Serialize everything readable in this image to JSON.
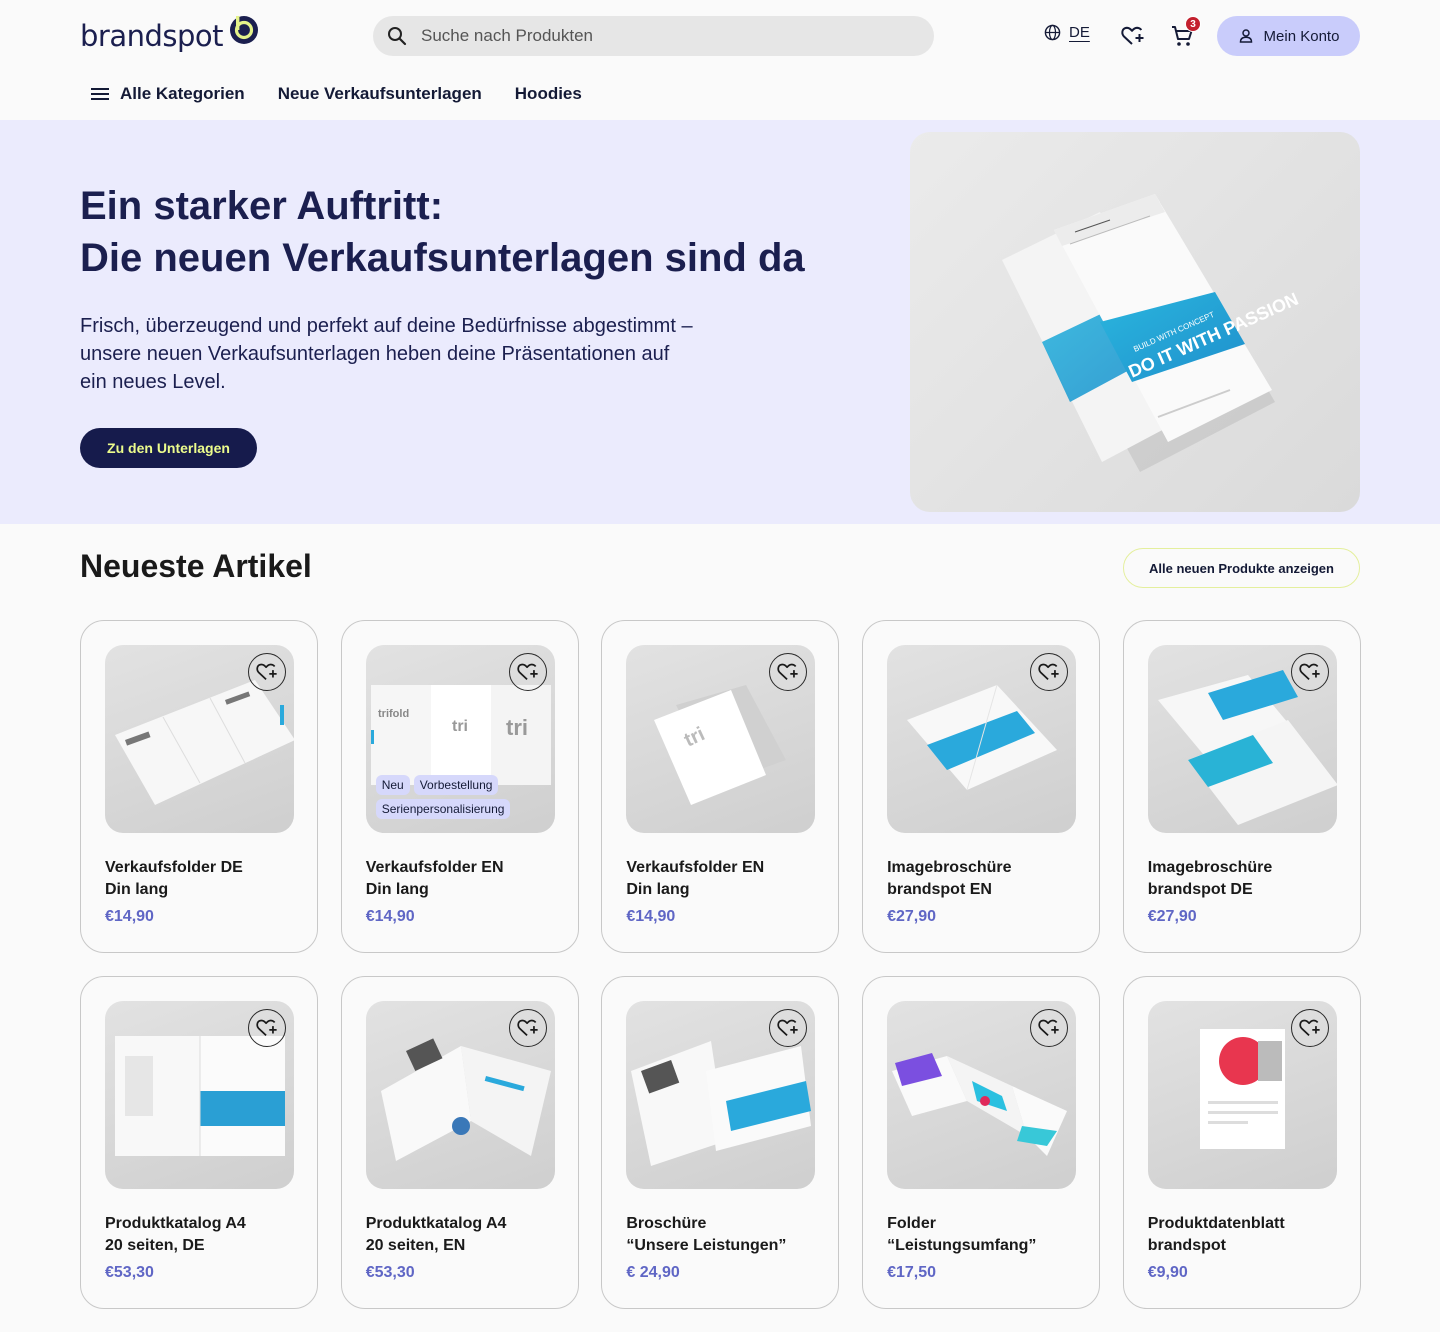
{
  "brand": {
    "logo_text": "brandspot",
    "accent": "#1b1f4f",
    "lime": "#e4f28a"
  },
  "header": {
    "search_placeholder": "Suche nach Produkten",
    "lang": "DE",
    "cart_count": "3",
    "account_label": "Mein Konto"
  },
  "nav": {
    "all_categories": "Alle Kategorien",
    "items": [
      "Neue Verkaufsunterlagen",
      "Hoodies"
    ]
  },
  "hero": {
    "title_line1": "Ein starker Auftritt:",
    "title_line2": "Die neuen Verkaufsunterlagen sind da",
    "text": "Frisch, überzeugend und perfekt auf deine Bedürfnisse abgestimmt – unsere neuen Verkaufsunterlagen heben deine Präsentationen auf ein neues Level.",
    "cta": "Zu den Unterlagen",
    "image_text": {
      "headline": "DO IT WITH PASSION",
      "sub": "BUILD WITH CONCEPT"
    }
  },
  "section": {
    "title": "Neueste Artikel",
    "all_button": "Alle neuen Produkte anzeigen"
  },
  "products": [
    {
      "line1": "Verkaufsfolder DE",
      "line2": "Din lang",
      "price": "€14,90",
      "icon": "trifold-mockup-icon"
    },
    {
      "line1": "Verkaufsfolder EN",
      "line2": "Din lang",
      "price": "€14,90",
      "icon": "trifold-mockup-icon",
      "tags": [
        "Neu",
        "Vorbestellung",
        "Serienpersonalisierung"
      ]
    },
    {
      "line1": "Verkaufsfolder EN",
      "line2": "Din lang",
      "price": "€14,90",
      "icon": "trifold-mockup-icon"
    },
    {
      "line1": "Imagebroschüre",
      "line2": "brandspot EN",
      "price": "€27,90",
      "icon": "brochure-icon"
    },
    {
      "line1": "Imagebroschüre",
      "line2": "brandspot DE",
      "price": "€27,90",
      "icon": "brochure-icon"
    },
    {
      "line1": "Produktkatalog A4",
      "line2": "20 seiten, DE",
      "price": "€53,30",
      "icon": "catalog-icon"
    },
    {
      "line1": "Produktkatalog A4",
      "line2": "20 seiten, EN",
      "price": "€53,30",
      "icon": "catalog-icon"
    },
    {
      "line1": "Broschüre",
      "line2": "“Unsere Leistungen”",
      "price": "€ 24,90",
      "icon": "brochure-icon"
    },
    {
      "line1": "Folder",
      "line2": "“Leistungsumfang”",
      "price": "€17,50",
      "icon": "folder-icon"
    },
    {
      "line1": "Produktdatenblatt",
      "line2": "brandspot",
      "price": "€9,90",
      "icon": "datasheet-icon"
    }
  ]
}
